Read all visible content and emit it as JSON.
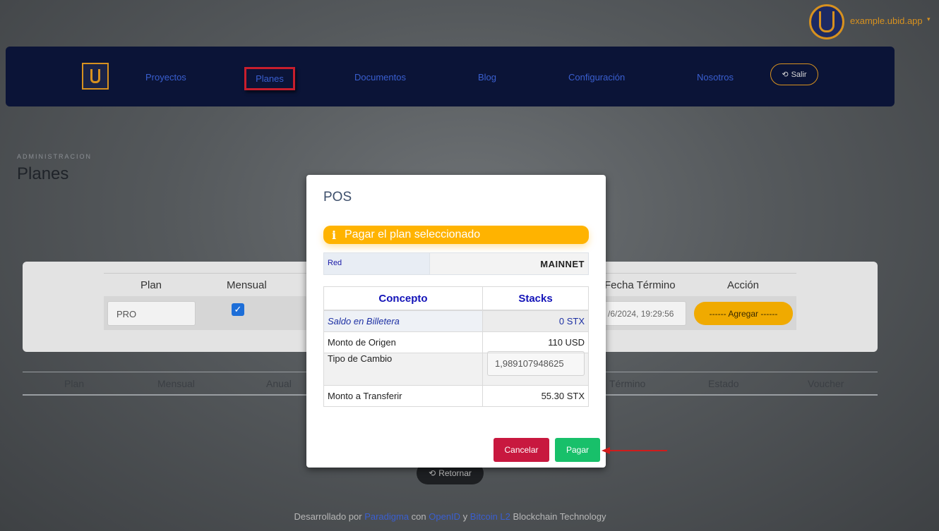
{
  "user": {
    "domain": "example.ubid.app"
  },
  "nav": {
    "items": [
      "Proyectos",
      "Planes",
      "Documentos",
      "Blog",
      "Configuración",
      "Nosotros"
    ],
    "active": "Planes",
    "logout": "Salir"
  },
  "page": {
    "breadcrumb": "ADMINISTRACION",
    "title": "Planes"
  },
  "plan_table": {
    "headers": [
      "Plan",
      "Mensual",
      "Fecha Término",
      "Acción"
    ],
    "row": {
      "plan": "PRO",
      "monthly_checked": true,
      "end_date": "/6/2024, 19:29:56",
      "action": "------ Agregar ------"
    }
  },
  "history_table": {
    "headers": [
      "Plan",
      "Mensual",
      "Anual",
      "Término",
      "Estado",
      "Voucher"
    ]
  },
  "retornar": "Retornar",
  "footer": {
    "p1": "Desarrollado por ",
    "l1": "Paradigma",
    "p2": " con ",
    "l2": "OpenID",
    "p3": " y ",
    "l3": "Bitcoin L2",
    "p4": " Blockchain Technology"
  },
  "modal": {
    "title": "POS",
    "alert": "Pagar el plan seleccionado",
    "network_label": "Red",
    "network_value": "MAINNET",
    "col_concept": "Concepto",
    "col_stacks": "Stacks",
    "rows": {
      "wallet_label": "Saldo en Billetera",
      "wallet_value": "0 STX",
      "origin_label": "Monto de Origen",
      "origin_value": "110 USD",
      "rate_label": "Tipo de Cambio",
      "rate_value": "1,989107948625",
      "transfer_label": "Monto a Transferir",
      "transfer_value": "55.30 STX"
    },
    "cancel": "Cancelar",
    "pay": "Pagar"
  },
  "colors": {
    "accent": "#d7911f",
    "navbar": "#0b1437",
    "alert": "#ffb300",
    "cancel": "#c8183f",
    "pay": "#18c06a"
  }
}
